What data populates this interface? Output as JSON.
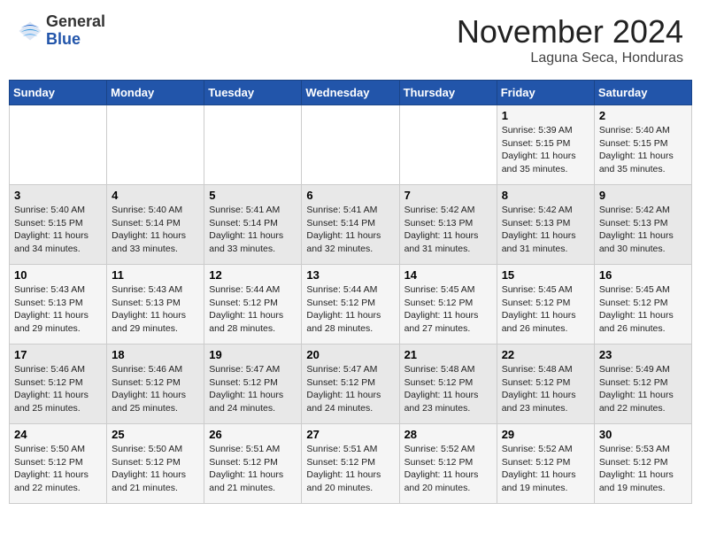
{
  "header": {
    "logo_general": "General",
    "logo_blue": "Blue",
    "month_title": "November 2024",
    "location": "Laguna Seca, Honduras"
  },
  "calendar": {
    "days_of_week": [
      "Sunday",
      "Monday",
      "Tuesday",
      "Wednesday",
      "Thursday",
      "Friday",
      "Saturday"
    ],
    "weeks": [
      [
        {
          "day": "",
          "info": ""
        },
        {
          "day": "",
          "info": ""
        },
        {
          "day": "",
          "info": ""
        },
        {
          "day": "",
          "info": ""
        },
        {
          "day": "",
          "info": ""
        },
        {
          "day": "1",
          "info": "Sunrise: 5:39 AM\nSunset: 5:15 PM\nDaylight: 11 hours and 35 minutes."
        },
        {
          "day": "2",
          "info": "Sunrise: 5:40 AM\nSunset: 5:15 PM\nDaylight: 11 hours and 35 minutes."
        }
      ],
      [
        {
          "day": "3",
          "info": "Sunrise: 5:40 AM\nSunset: 5:15 PM\nDaylight: 11 hours and 34 minutes."
        },
        {
          "day": "4",
          "info": "Sunrise: 5:40 AM\nSunset: 5:14 PM\nDaylight: 11 hours and 33 minutes."
        },
        {
          "day": "5",
          "info": "Sunrise: 5:41 AM\nSunset: 5:14 PM\nDaylight: 11 hours and 33 minutes."
        },
        {
          "day": "6",
          "info": "Sunrise: 5:41 AM\nSunset: 5:14 PM\nDaylight: 11 hours and 32 minutes."
        },
        {
          "day": "7",
          "info": "Sunrise: 5:42 AM\nSunset: 5:13 PM\nDaylight: 11 hours and 31 minutes."
        },
        {
          "day": "8",
          "info": "Sunrise: 5:42 AM\nSunset: 5:13 PM\nDaylight: 11 hours and 31 minutes."
        },
        {
          "day": "9",
          "info": "Sunrise: 5:42 AM\nSunset: 5:13 PM\nDaylight: 11 hours and 30 minutes."
        }
      ],
      [
        {
          "day": "10",
          "info": "Sunrise: 5:43 AM\nSunset: 5:13 PM\nDaylight: 11 hours and 29 minutes."
        },
        {
          "day": "11",
          "info": "Sunrise: 5:43 AM\nSunset: 5:13 PM\nDaylight: 11 hours and 29 minutes."
        },
        {
          "day": "12",
          "info": "Sunrise: 5:44 AM\nSunset: 5:12 PM\nDaylight: 11 hours and 28 minutes."
        },
        {
          "day": "13",
          "info": "Sunrise: 5:44 AM\nSunset: 5:12 PM\nDaylight: 11 hours and 28 minutes."
        },
        {
          "day": "14",
          "info": "Sunrise: 5:45 AM\nSunset: 5:12 PM\nDaylight: 11 hours and 27 minutes."
        },
        {
          "day": "15",
          "info": "Sunrise: 5:45 AM\nSunset: 5:12 PM\nDaylight: 11 hours and 26 minutes."
        },
        {
          "day": "16",
          "info": "Sunrise: 5:45 AM\nSunset: 5:12 PM\nDaylight: 11 hours and 26 minutes."
        }
      ],
      [
        {
          "day": "17",
          "info": "Sunrise: 5:46 AM\nSunset: 5:12 PM\nDaylight: 11 hours and 25 minutes."
        },
        {
          "day": "18",
          "info": "Sunrise: 5:46 AM\nSunset: 5:12 PM\nDaylight: 11 hours and 25 minutes."
        },
        {
          "day": "19",
          "info": "Sunrise: 5:47 AM\nSunset: 5:12 PM\nDaylight: 11 hours and 24 minutes."
        },
        {
          "day": "20",
          "info": "Sunrise: 5:47 AM\nSunset: 5:12 PM\nDaylight: 11 hours and 24 minutes."
        },
        {
          "day": "21",
          "info": "Sunrise: 5:48 AM\nSunset: 5:12 PM\nDaylight: 11 hours and 23 minutes."
        },
        {
          "day": "22",
          "info": "Sunrise: 5:48 AM\nSunset: 5:12 PM\nDaylight: 11 hours and 23 minutes."
        },
        {
          "day": "23",
          "info": "Sunrise: 5:49 AM\nSunset: 5:12 PM\nDaylight: 11 hours and 22 minutes."
        }
      ],
      [
        {
          "day": "24",
          "info": "Sunrise: 5:50 AM\nSunset: 5:12 PM\nDaylight: 11 hours and 22 minutes."
        },
        {
          "day": "25",
          "info": "Sunrise: 5:50 AM\nSunset: 5:12 PM\nDaylight: 11 hours and 21 minutes."
        },
        {
          "day": "26",
          "info": "Sunrise: 5:51 AM\nSunset: 5:12 PM\nDaylight: 11 hours and 21 minutes."
        },
        {
          "day": "27",
          "info": "Sunrise: 5:51 AM\nSunset: 5:12 PM\nDaylight: 11 hours and 20 minutes."
        },
        {
          "day": "28",
          "info": "Sunrise: 5:52 AM\nSunset: 5:12 PM\nDaylight: 11 hours and 20 minutes."
        },
        {
          "day": "29",
          "info": "Sunrise: 5:52 AM\nSunset: 5:12 PM\nDaylight: 11 hours and 19 minutes."
        },
        {
          "day": "30",
          "info": "Sunrise: 5:53 AM\nSunset: 5:12 PM\nDaylight: 11 hours and 19 minutes."
        }
      ]
    ]
  }
}
